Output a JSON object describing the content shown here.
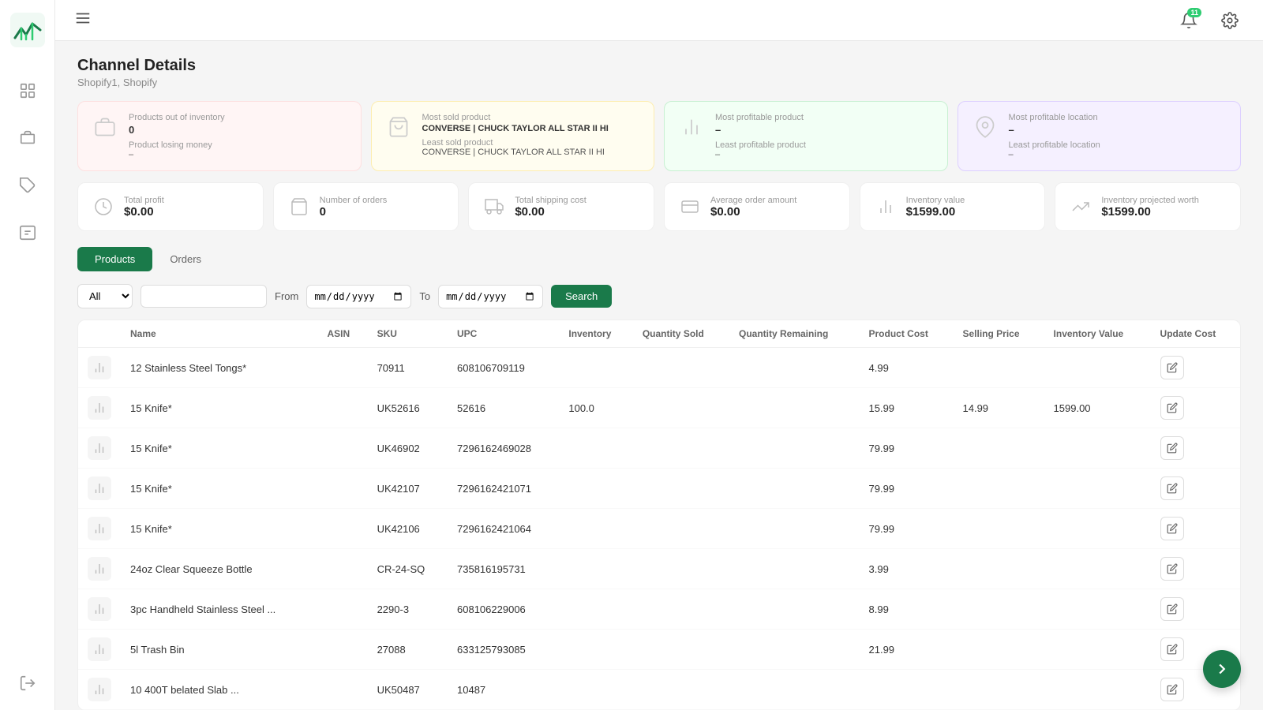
{
  "sidebar": {
    "logo_alt": "Logo",
    "items": [
      {
        "name": "menu-icon",
        "label": "Menu"
      },
      {
        "name": "dashboard-icon",
        "label": "Dashboard"
      },
      {
        "name": "products-icon",
        "label": "Products"
      },
      {
        "name": "tags-icon",
        "label": "Tags"
      },
      {
        "name": "orders-icon",
        "label": "Orders"
      },
      {
        "name": "logout-icon",
        "label": "Logout"
      }
    ]
  },
  "topbar": {
    "notification_count": "11",
    "settings_label": "Settings"
  },
  "page": {
    "title": "Channel Details",
    "subtitle": "Shopify1, Shopify"
  },
  "summary_cards": [
    {
      "label": "Products out of inventory",
      "value": "0",
      "sublabel": "Product losing money",
      "subvalue": "–",
      "color": "pink"
    },
    {
      "label": "Most sold product",
      "value": "CONVERSE | CHUCK TAYLOR ALL STAR II HI",
      "sublabel": "Least sold product",
      "subvalue": "CONVERSE | CHUCK TAYLOR ALL STAR II HI",
      "color": "yellow"
    },
    {
      "label": "Most profitable product",
      "value": "–",
      "sublabel": "Least profitable product",
      "subvalue": "–",
      "color": "green"
    },
    {
      "label": "Most profitable location",
      "value": "–",
      "sublabel": "Least profitable location",
      "subvalue": "–",
      "color": "purple"
    }
  ],
  "stats": [
    {
      "label": "Total profit",
      "value": "$0.00"
    },
    {
      "label": "Number of orders",
      "value": "0"
    },
    {
      "label": "Total shipping cost",
      "value": "$0.00"
    },
    {
      "label": "Average order amount",
      "value": "$0.00"
    },
    {
      "label": "Inventory value",
      "value": "$1599.00"
    },
    {
      "label": "Inventory projected worth",
      "value": "$1599.00"
    }
  ],
  "tabs": [
    {
      "label": "Products",
      "active": true
    },
    {
      "label": "Orders",
      "active": false
    }
  ],
  "filter": {
    "select_default": "All",
    "search_placeholder": "",
    "from_label": "From",
    "to_label": "To",
    "search_button": "Search",
    "from_value": "mm/dd/yyyy",
    "to_value": "mm/dd/yyyy"
  },
  "table": {
    "columns": [
      "",
      "Name",
      "ASIN",
      "SKU",
      "UPC",
      "Inventory",
      "Quantity Sold",
      "Quantity Remaining",
      "Product Cost",
      "Selling Price",
      "Inventory Value",
      "Update Cost"
    ],
    "rows": [
      {
        "name": "12 Stainless Steel Tongs*",
        "asin": "",
        "sku": "70911",
        "upc": "608106709119",
        "inventory": "",
        "qty_sold": "",
        "qty_remaining": "",
        "product_cost": "4.99",
        "selling_price": "",
        "inventory_value": "",
        "update_cost": ""
      },
      {
        "name": "15 Knife*",
        "asin": "",
        "sku": "UK52616",
        "upc": "52616",
        "inventory": "100.0",
        "qty_sold": "",
        "qty_remaining": "",
        "product_cost": "15.99",
        "selling_price": "14.99",
        "inventory_value": "1599.00",
        "update_cost": ""
      },
      {
        "name": "15 Knife*",
        "asin": "",
        "sku": "UK46902",
        "upc": "7296162469028",
        "inventory": "",
        "qty_sold": "",
        "qty_remaining": "",
        "product_cost": "79.99",
        "selling_price": "",
        "inventory_value": "",
        "update_cost": ""
      },
      {
        "name": "15 Knife*",
        "asin": "",
        "sku": "UK42107",
        "upc": "7296162421071",
        "inventory": "",
        "qty_sold": "",
        "qty_remaining": "",
        "product_cost": "79.99",
        "selling_price": "",
        "inventory_value": "",
        "update_cost": ""
      },
      {
        "name": "15 Knife*",
        "asin": "",
        "sku": "UK42106",
        "upc": "7296162421064",
        "inventory": "",
        "qty_sold": "",
        "qty_remaining": "",
        "product_cost": "79.99",
        "selling_price": "",
        "inventory_value": "",
        "update_cost": ""
      },
      {
        "name": "24oz Clear Squeeze Bottle",
        "asin": "",
        "sku": "CR-24-SQ",
        "upc": "735816195731",
        "inventory": "",
        "qty_sold": "",
        "qty_remaining": "",
        "product_cost": "3.99",
        "selling_price": "",
        "inventory_value": "",
        "update_cost": ""
      },
      {
        "name": "3pc Handheld Stainless Steel ...",
        "asin": "",
        "sku": "2290-3",
        "upc": "608106229006",
        "inventory": "",
        "qty_sold": "",
        "qty_remaining": "",
        "product_cost": "8.99",
        "selling_price": "",
        "inventory_value": "",
        "update_cost": ""
      },
      {
        "name": "5l Trash Bin",
        "asin": "",
        "sku": "27088",
        "upc": "633125793085",
        "inventory": "",
        "qty_sold": "",
        "qty_remaining": "",
        "product_cost": "21.99",
        "selling_price": "",
        "inventory_value": "",
        "update_cost": ""
      },
      {
        "name": "10 400T belated Slab ...",
        "asin": "",
        "sku": "UK50487",
        "upc": "10487",
        "inventory": "",
        "qty_sold": "",
        "qty_remaining": "",
        "product_cost": "",
        "selling_price": "",
        "inventory_value": "",
        "update_cost": ""
      }
    ]
  },
  "help_button_label": "❯",
  "colors": {
    "accent": "#1a7a4a",
    "notification": "#2ecc71"
  }
}
